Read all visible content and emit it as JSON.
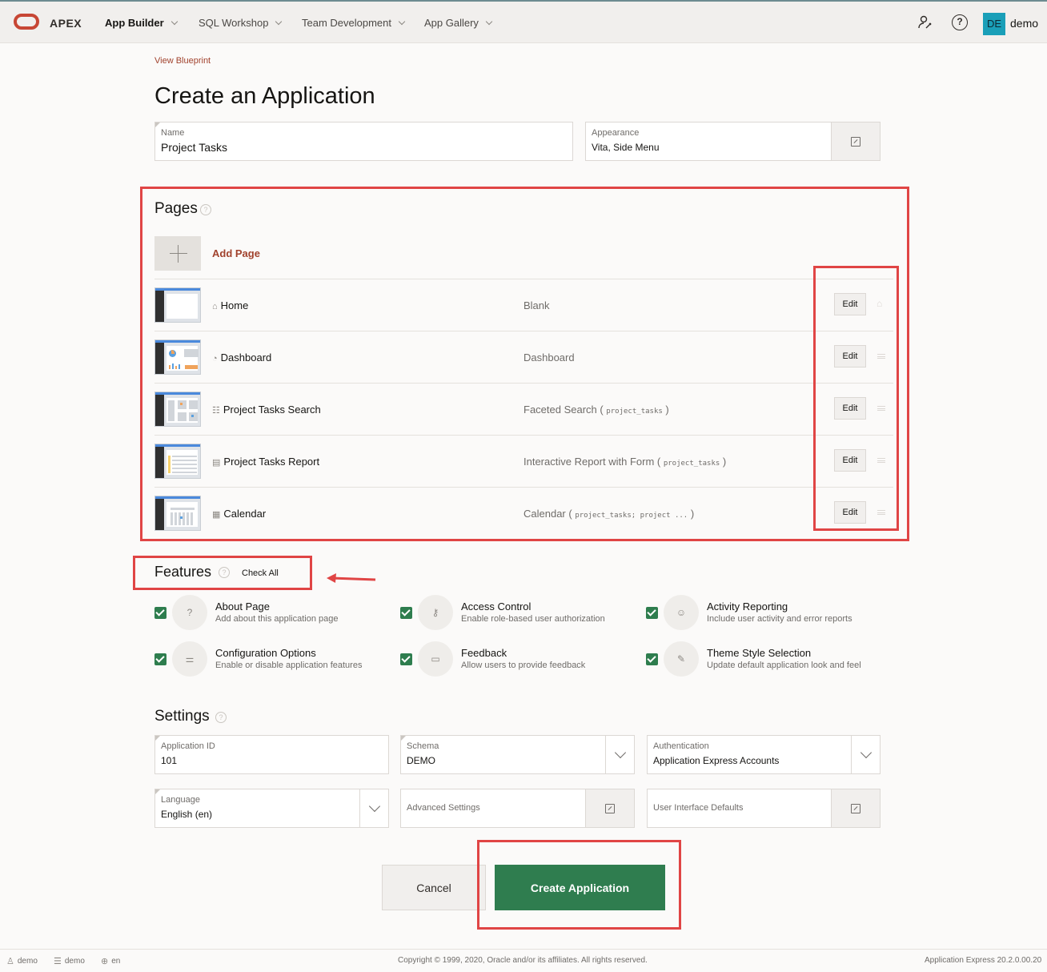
{
  "header": {
    "logo_text": "APEX",
    "nav": [
      {
        "label": "App Builder"
      },
      {
        "label": "SQL Workshop"
      },
      {
        "label": "Team Development"
      },
      {
        "label": "App Gallery"
      }
    ],
    "avatar_initials": "DE",
    "user_name": "demo"
  },
  "breadcrumb_link": "View Blueprint",
  "title": "Create an Application",
  "name_field": {
    "label": "Name",
    "value": "Project Tasks"
  },
  "appearance_field": {
    "label": "Appearance",
    "value": "Vita, Side Menu"
  },
  "pages": {
    "title": "Pages",
    "add_label": "Add Page",
    "rows": [
      {
        "name": "Home",
        "icon": "home-icon",
        "type": "Blank",
        "source": "",
        "edit": "Edit"
      },
      {
        "name": "Dashboard",
        "icon": "dashboard-icon",
        "type": "Dashboard",
        "source": "",
        "edit": "Edit"
      },
      {
        "name": "Project Tasks Search",
        "icon": "faceted-search-icon",
        "type": "Faceted Search (",
        "source": "project_tasks",
        "close": ")",
        "edit": "Edit"
      },
      {
        "name": "Project Tasks Report",
        "icon": "report-icon",
        "type": "Interactive Report with Form (",
        "source": "project_tasks",
        "close": ")",
        "edit": "Edit"
      },
      {
        "name": "Calendar",
        "icon": "calendar-icon",
        "type": "Calendar (",
        "source": "project_tasks; project ...",
        "close": ")",
        "edit": "Edit"
      }
    ]
  },
  "features": {
    "title": "Features",
    "check_all": "Check All",
    "items": [
      {
        "title": "About Page",
        "desc": "Add about this application page",
        "icon": "question-icon"
      },
      {
        "title": "Access Control",
        "desc": "Enable role-based user authorization",
        "icon": "key-icon"
      },
      {
        "title": "Activity Reporting",
        "desc": "Include user activity and error reports",
        "icon": "user-activity-icon"
      },
      {
        "title": "Configuration Options",
        "desc": "Enable or disable application features",
        "icon": "sliders-icon"
      },
      {
        "title": "Feedback",
        "desc": "Allow users to provide feedback",
        "icon": "comment-icon"
      },
      {
        "title": "Theme Style Selection",
        "desc": "Update default application look and feel",
        "icon": "brush-icon"
      }
    ]
  },
  "settings": {
    "title": "Settings",
    "app_id": {
      "label": "Application ID",
      "value": "101"
    },
    "schema": {
      "label": "Schema",
      "value": "DEMO"
    },
    "authentication": {
      "label": "Authentication",
      "value": "Application Express Accounts"
    },
    "language": {
      "label": "Language",
      "value": "English (en)"
    },
    "advanced": "Advanced Settings",
    "ui_defaults": "User Interface Defaults"
  },
  "buttons": {
    "cancel": "Cancel",
    "create": "Create Application"
  },
  "footer": {
    "user": "demo",
    "schema": "demo",
    "language": "en",
    "copyright": "Copyright © 1999, 2020, Oracle and/or its affiliates. All rights reserved.",
    "version": "Application Express 20.2.0.00.20"
  },
  "colors": {
    "primary": "#2f7d4f",
    "accent_link": "#a1422d",
    "annotation": "#e04545",
    "oracle_red": "#c74634"
  }
}
